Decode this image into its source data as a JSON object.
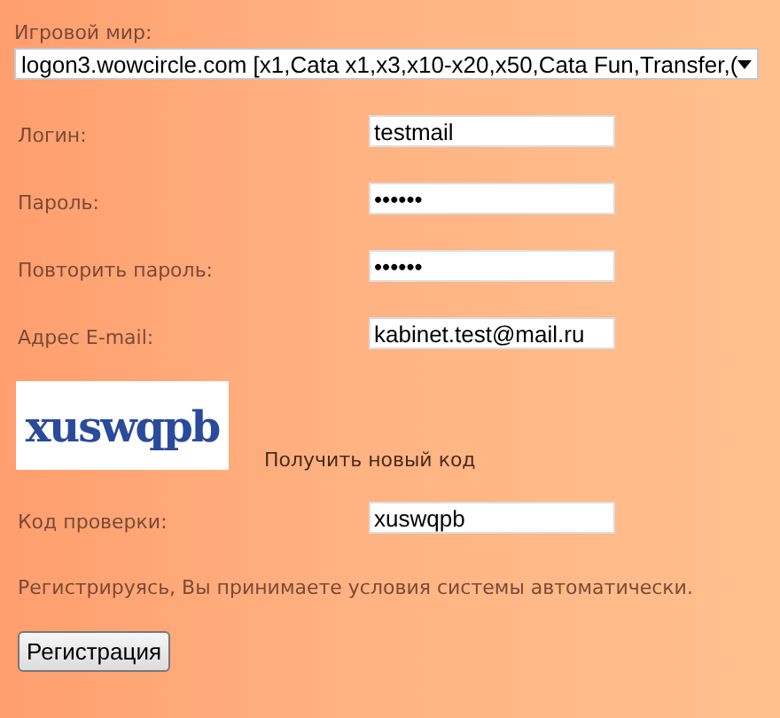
{
  "world": {
    "label": "Игровой мир:",
    "value": "logon3.wowcircle.com [x1,Cata x1,x3,x10-x20,x50,Cata Fun,Transfer,("
  },
  "fields": [
    {
      "label": "Логин:",
      "value": "testmail"
    },
    {
      "label": "Пароль:",
      "value": "••••••"
    },
    {
      "label": "Повторить пароль:",
      "value": "••••••"
    },
    {
      "label": "Адрес E-mail:",
      "value": "kabinet.test@mail.ru"
    }
  ],
  "captcha": {
    "code": "xuswqpb",
    "refresh": "Получить новый код"
  },
  "check": {
    "label": "Код проверки:",
    "value": "xuswqpb"
  },
  "notice": "Регистрируясь, Вы принимаете условия системы автоматически.",
  "submit": "Регистрация"
}
